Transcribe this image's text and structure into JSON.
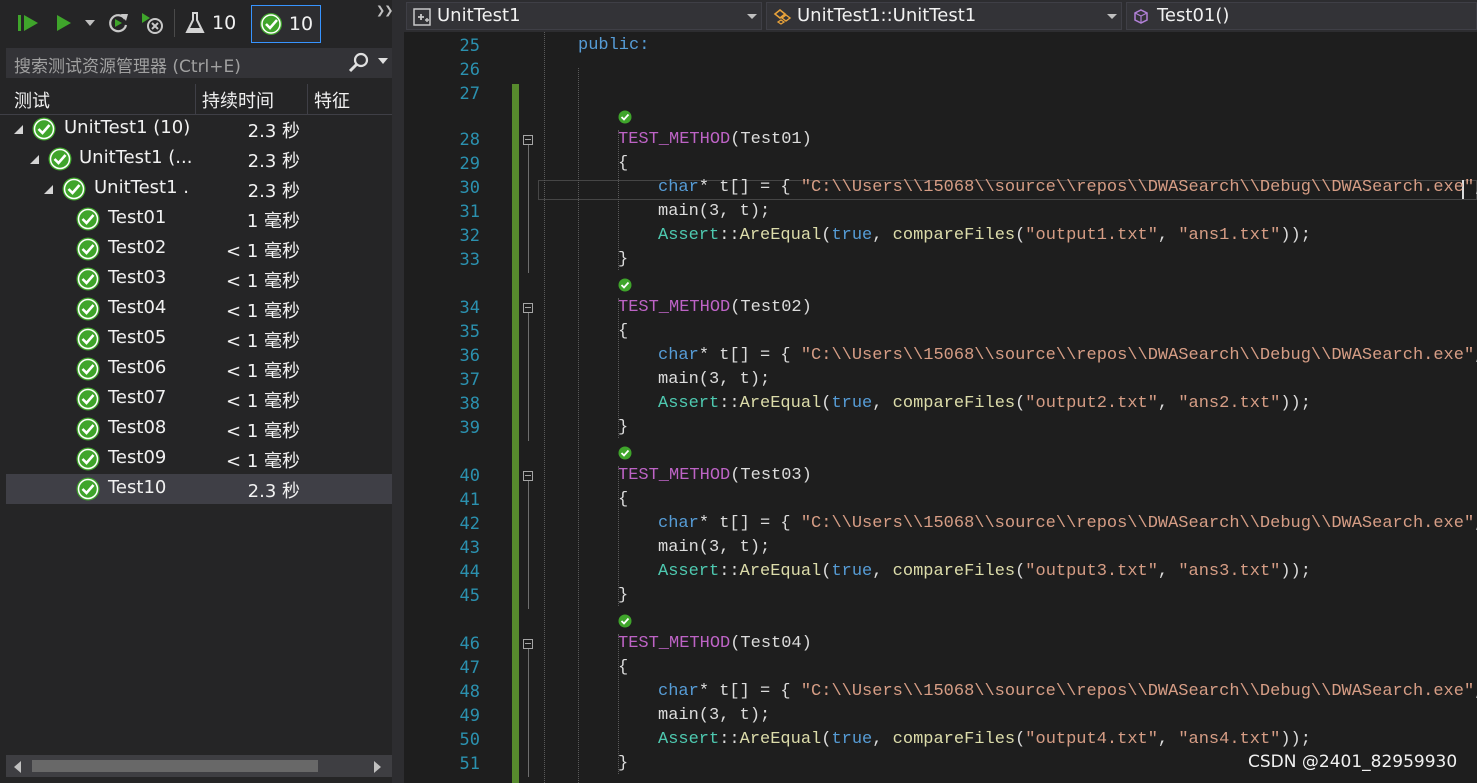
{
  "toolbar": {
    "total_count": "10",
    "passed_count": "10",
    "buttons": [
      "run-all-icon",
      "run-icon",
      "repeat-icon",
      "cancel-icon",
      "flask-icon",
      "passed-check-icon"
    ]
  },
  "search": {
    "placeholder": "搜索测试资源管理器 (Ctrl+E)"
  },
  "columns": {
    "test": "测试",
    "duration": "持续时间",
    "traits": "特征"
  },
  "tree": [
    {
      "name": "UnitTest1 (10)",
      "duration": "2.3 秒",
      "level": 0
    },
    {
      "name": "UnitTest1 (...",
      "duration": "2.3 秒",
      "level": 1
    },
    {
      "name": "UnitTest1 .",
      "duration": "2.3 秒",
      "level": 2
    },
    {
      "name": "Test01",
      "duration": "1 毫秒",
      "level": 3
    },
    {
      "name": "Test02",
      "duration": "< 1 毫秒",
      "level": 3
    },
    {
      "name": "Test03",
      "duration": "< 1 毫秒",
      "level": 3
    },
    {
      "name": "Test04",
      "duration": "< 1 毫秒",
      "level": 3
    },
    {
      "name": "Test05",
      "duration": "< 1 毫秒",
      "level": 3
    },
    {
      "name": "Test06",
      "duration": "< 1 毫秒",
      "level": 3
    },
    {
      "name": "Test07",
      "duration": "< 1 毫秒",
      "level": 3
    },
    {
      "name": "Test08",
      "duration": "< 1 毫秒",
      "level": 3
    },
    {
      "name": "Test09",
      "duration": "< 1 毫秒",
      "level": 3
    },
    {
      "name": "Test10",
      "duration": "2.3 秒",
      "level": 3,
      "selected": true
    }
  ],
  "navbar": {
    "project": "UnitTest1",
    "scope": "UnitTest1::UnitTest1",
    "member": "Test01()"
  },
  "editor": {
    "line_numbers": [
      "25",
      "26",
      "27",
      "28",
      "29",
      "30",
      "31",
      "32",
      "33",
      "34",
      "35",
      "36",
      "37",
      "38",
      "39",
      "40",
      "41",
      "42",
      "43",
      "44",
      "45",
      "46",
      "47",
      "48",
      "49",
      "50",
      "51"
    ],
    "public_label": "public:",
    "tests": [
      {
        "macro": "TEST_METHOD",
        "arg": "(Test01)",
        "open": "{",
        "decl_type": "char",
        "decl_rest": "* t[] = { ",
        "path": "\"C:\\\\Users\\\\15068\\\\source\\\\repos\\\\DWASearch\\\\Debug\\\\DWASearch.exe\"",
        "path_tail": ",\"i",
        "main_call": "main(3, t);",
        "assert_class": "Assert",
        "assert_sep": "::",
        "assert_fn": "AreEqual",
        "assert_open": "(",
        "true_kw": "true",
        "comma": ", ",
        "compare_fn": "compareFiles",
        "cf_open": "(",
        "out_file": "\"output1.txt\"",
        "sep2": ", ",
        "ans_file": "\"ans1.txt\"",
        "close": "));",
        "close_brace": "}"
      },
      {
        "macro": "TEST_METHOD",
        "arg": "(Test02)",
        "open": "{",
        "decl_type": "char",
        "decl_rest": "* t[] = { ",
        "path": "\"C:\\\\Users\\\\15068\\\\source\\\\repos\\\\DWASearch\\\\Debug\\\\DWASearch.exe\"",
        "path_tail": ",\"in",
        "main_call": "main(3, t);",
        "assert_class": "Assert",
        "assert_sep": "::",
        "assert_fn": "AreEqual",
        "assert_open": "(",
        "true_kw": "true",
        "comma": ", ",
        "compare_fn": "compareFiles",
        "cf_open": "(",
        "out_file": "\"output2.txt\"",
        "sep2": ", ",
        "ans_file": "\"ans2.txt\"",
        "close": "));",
        "close_brace": "}"
      },
      {
        "macro": "TEST_METHOD",
        "arg": "(Test03)",
        "open": "{",
        "decl_type": "char",
        "decl_rest": "* t[] = { ",
        "path": "\"C:\\\\Users\\\\15068\\\\source\\\\repos\\\\DWASearch\\\\Debug\\\\DWASearch.exe\"",
        "path_tail": ",\"in",
        "main_call": "main(3, t);",
        "assert_class": "Assert",
        "assert_sep": "::",
        "assert_fn": "AreEqual",
        "assert_open": "(",
        "true_kw": "true",
        "comma": ", ",
        "compare_fn": "compareFiles",
        "cf_open": "(",
        "out_file": "\"output3.txt\"",
        "sep2": ", ",
        "ans_file": "\"ans3.txt\"",
        "close": "));",
        "close_brace": "}"
      },
      {
        "macro": "TEST_METHOD",
        "arg": "(Test04)",
        "open": "{",
        "decl_type": "char",
        "decl_rest": "* t[] = { ",
        "path": "\"C:\\\\Users\\\\15068\\\\source\\\\repos\\\\DWASearch\\\\Debug\\\\DWASearch.exe\"",
        "path_tail": ",\"in",
        "main_call": "main(3, t);",
        "assert_class": "Assert",
        "assert_sep": "::",
        "assert_fn": "AreEqual",
        "assert_open": "(",
        "true_kw": "true",
        "comma": ", ",
        "compare_fn": "compareFiles",
        "cf_open": "(",
        "out_file": "\"output4.txt\"",
        "sep2": ", ",
        "ans_file": "\"ans4.txt\"",
        "close": "));",
        "close_brace": "}"
      }
    ]
  },
  "watermark": "CSDN @2401_82959930",
  "colors": {
    "accent": "#3794ff",
    "passed": "#3fa52b",
    "change_bar": "#578a2d"
  }
}
